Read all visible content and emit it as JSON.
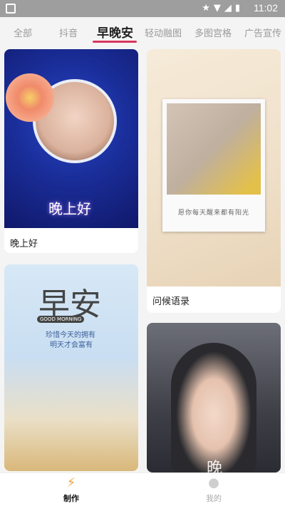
{
  "status_bar": {
    "time": "11:02",
    "icons": [
      "star-icon",
      "wifi-icon",
      "signal-icon",
      "battery-icon"
    ]
  },
  "tabs": [
    {
      "label": "全部",
      "active": false
    },
    {
      "label": "抖音",
      "active": false
    },
    {
      "label": "早晚安",
      "active": true
    },
    {
      "label": "轻动融图",
      "active": false
    },
    {
      "label": "多图宫格",
      "active": false
    },
    {
      "label": "广告宣传",
      "active": false
    }
  ],
  "cards": [
    {
      "caption": "晚上好",
      "overlay_text": "晚上好"
    },
    {
      "caption": "问候语录",
      "overlay_text": "愿你每天醒来都有阳光"
    },
    {
      "caption": "",
      "overlay_title": "早安",
      "overlay_badge": "GOOD MORNING",
      "overlay_line1": "珍惜今天的拥有",
      "overlay_line2": "明天才会富有"
    },
    {
      "caption": "",
      "overlay_text": "晚"
    }
  ],
  "bottom_nav": [
    {
      "label": "制作",
      "icon": "lightning-icon",
      "active": true
    },
    {
      "label": "我的",
      "icon": "duck-icon",
      "active": false
    }
  ],
  "colors": {
    "accent": "#d9365e",
    "status_bar": "#9e9e9e"
  }
}
